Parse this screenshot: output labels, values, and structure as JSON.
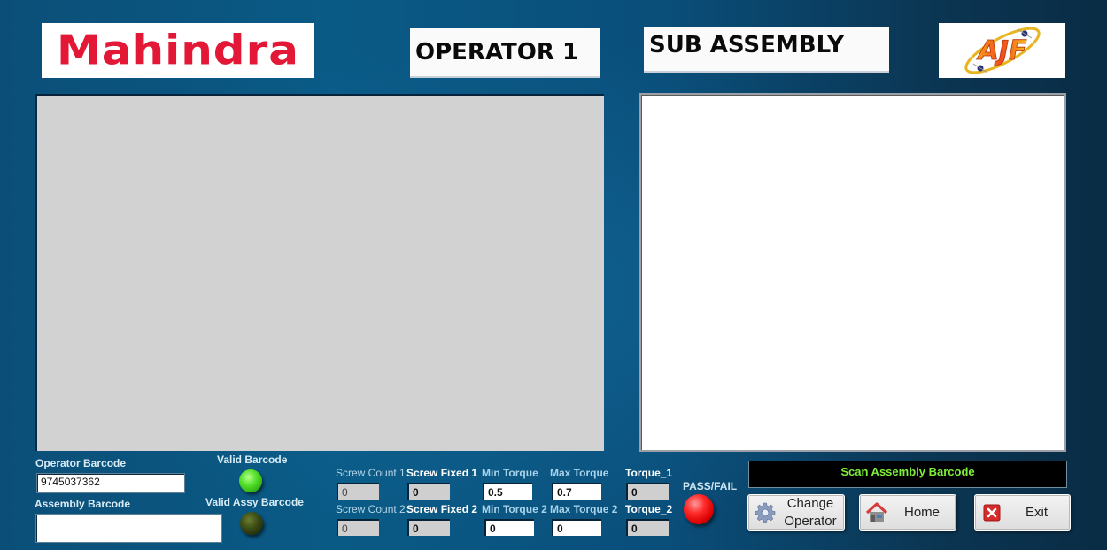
{
  "header": {
    "brand_logo_text": "Mahindra",
    "operator_title": "OPERATOR 1",
    "station_title": "SUB ASSEMBLY",
    "partner_logo_text": "AJF"
  },
  "barcodes": {
    "operator_label": "Operator Barcode",
    "operator_value": "9745037362",
    "assembly_label": "Assembly Barcode",
    "assembly_value": "",
    "valid_barcode_label": "Valid Barcode",
    "valid_barcode_state": "on",
    "valid_assy_label": "Valid Assy Barcode",
    "valid_assy_state": "off"
  },
  "screws": {
    "row1": {
      "count_label": "Screw Count 1",
      "count_value": "0",
      "fixed_label": "Screw Fixed 1",
      "fixed_value": "0",
      "min_label": "Min Torque",
      "min_value": "0.5",
      "max_label": "Max Torque",
      "max_value": "0.7",
      "torque_label": "Torque_1",
      "torque_value": "0"
    },
    "row2": {
      "count_label": "Screw Count 2",
      "count_value": "0",
      "fixed_label": "Screw Fixed 2",
      "fixed_value": "0",
      "min_label": "Min Torque 2",
      "min_value": "0",
      "max_label": "Max Torque 2",
      "max_value": "0",
      "torque_label": "Torque_2",
      "torque_value": "0"
    }
  },
  "result": {
    "label": "PASS/FAIL",
    "state": "fail",
    "color": "#e00000"
  },
  "status": {
    "message": "Scan Assembly Barcode",
    "color": "#7ef03a"
  },
  "buttons": {
    "change_operator_line1": "Change",
    "change_operator_line2": "Operator",
    "home": "Home",
    "exit": "Exit"
  },
  "colors": {
    "brand_red": "#e31837",
    "led_green": "#53e02a",
    "led_off": "#3a4a14"
  }
}
